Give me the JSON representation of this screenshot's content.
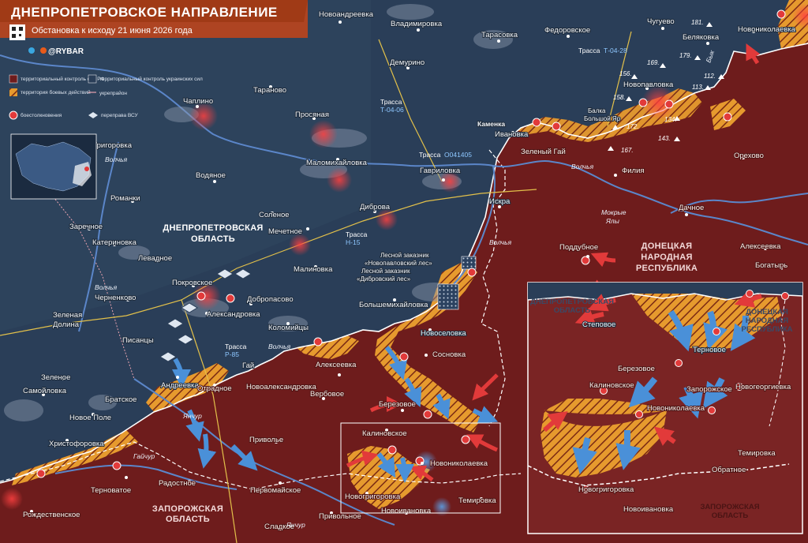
{
  "header": {
    "title": "ДНЕПРОПЕТРОВСКОЕ НАПРАВЛЕНИЕ",
    "subtitle": "Обстановка к исходу 21 июня 2026 года",
    "brand": "@RYBAR",
    "brand_color": "#e85a1a"
  },
  "legend": {
    "rf_control": "территориальный контроль сил РФ",
    "ua_control": "территориальный контроль украинских сил",
    "combat_zone": "территория боевых действий",
    "fortified": "укрепрайон",
    "clashes": "боестолкновения",
    "crossing": "переправа ВСУ"
  },
  "colors": {
    "rf_territory": "#6e1c1c",
    "ua_territory": "#2a3e58",
    "combat_hatch": "#e69a2e",
    "front_line": "#ffffff",
    "attack_arrow_rf": "#e23a3a",
    "attack_arrow_ua": "#4a90d8"
  },
  "regions": {
    "dnepro": [
      "ДНЕПРОПЕТРОВСКАЯ",
      "ОБЛАСТЬ"
    ],
    "donetsk": [
      "ДОНЕЦКАЯ",
      "НАРОДНАЯ",
      "РЕСПУБЛИКА"
    ],
    "zaporozhye": [
      "ЗАПОРОЖСКАЯ",
      "ОБЛАСТЬ"
    ]
  },
  "rivers": {
    "volchya_1": "Волчья",
    "volchya_2": "Волчья",
    "volchya_3": "Волчья",
    "volchya_4": "Волчья",
    "volchya_5": "Волчья",
    "yanchur_1": "Янчур",
    "yanchur_2": "Янчур",
    "gaichur": "Гайчур",
    "mokrye_yaly": [
      "Мокрые",
      "Ялы"
    ],
    "byk": "Бык"
  },
  "roads": {
    "t0406": [
      "Трасса",
      "Т-04-06"
    ],
    "t0428_label": "Трасса",
    "t0428_num": "Т-04-28",
    "o041405_label": "Трасса",
    "o041405_num": "О041405",
    "n15": [
      "Трасса",
      "Н-15"
    ],
    "r85": [
      "Трасса",
      "Р-85"
    ]
  },
  "reserves": {
    "novopavlovsky": [
      "Лесной заказник",
      "«Новопавловский лес»"
    ],
    "dibrovsky": [
      "Лесной заказник",
      "«Дибровский лес»"
    ],
    "balka": [
      "Балка",
      "Большой Яр"
    ]
  },
  "altitudes": [
    "181.",
    "179.",
    "169.",
    "156.",
    "112.",
    "113.",
    "158.",
    "134.",
    "172.",
    "143.",
    "167."
  ],
  "settlements": {
    "novoandreevka": "Новоандреевка",
    "vladimirovka": "Владимировка",
    "tarasovka": "Тарасовка",
    "fedorovskoe": "Федоровское",
    "chuguevo": "Чугуево",
    "belyakovka": "Беляковка",
    "novonikolaevka_ne": "Новониколаевка",
    "demurino": "Демурино",
    "chaplino": "Чаплино",
    "taranovo": "Тараново",
    "prosyanaya": "Просяная",
    "novopavlovka": "Новопавловка",
    "grigorovka": "Григоровка",
    "malomikhailovka": "Маломихайловка",
    "kamenka": "Каменка",
    "ivanovka": "Ивановка",
    "vodyanoe": "Водяное",
    "gavrilovka": "Гавриловка",
    "zeleny_gai": "Зеленый Гай",
    "filiya": "Филия",
    "orekhovo": "Орехово",
    "romanki": "Романки",
    "solenoe": "Соленое",
    "dibrova": "Диброва",
    "iskra": "Искра",
    "dachnoe": "Дачное",
    "zarechnoe": "Заречное",
    "mechetnoe": "Мечетное",
    "katerinovka": "Катериновка",
    "poddubnoe": "Поддубное",
    "alekseevka_e": "Алексеевка",
    "levadnoe": "Левадное",
    "bogatyr": "Богатырь",
    "malinovka": "Малиновка",
    "pokrovskoe": "Покровское",
    "chernenkovo": "Черненково",
    "dobropasovo": "Добропасово",
    "bolshemikhailovka": "Большемихайловка",
    "aleksandrovka": "Александровка",
    "zelenaya_dolina": [
      "Зеленая",
      "Долина"
    ],
    "kolomiytsy": "Коломийцы",
    "novoselovka": "Новоселовка",
    "pisantsy": "Писанцы",
    "sosnovka": "Сосновка",
    "gai": "Гай",
    "alekseevka": "Алексеевка",
    "zelenoe": "Зеленое",
    "andreevka": "Андреевка",
    "otradnoe": "Отрадное",
    "novoaleksandrovka": "Новоалександровка",
    "samoylovka": "Самойловка",
    "bratskoe": "Братское",
    "verbovoe": "Вербовое",
    "novoe_pole": "Новое Поле",
    "berezovoe": "Березовое",
    "kalinovskoe": "Калиновское",
    "khristoforovka": "Христофоровка",
    "privolye": "Приволье",
    "novonikolaevka": "Новониколаевка",
    "ternovatoe": "Терноватое",
    "radostnoe": "Радостное",
    "pervomayskoe": "Первомайское",
    "novogrigorovka": "Новогригоровка",
    "temirovka": "Темировка",
    "rozhdestvenskoe": "Рождественское",
    "privolnoe": "Привольное",
    "novoivanovka": "Новоивановка",
    "sladkoe": "Сладкое"
  },
  "inset": {
    "dnepro_region": [
      "ДНЕПРОПЕТРОВСКАЯ",
      "ОБЛАСТЬ"
    ],
    "donetsk_region": [
      "ДОНЕЦКАЯ",
      "НАРОДНАЯ",
      "РЕСПУБЛИКА"
    ],
    "zaporozhye_region": [
      "ЗАПОРОЖСКАЯ",
      "ОБЛАСТЬ"
    ],
    "stepovoe": "Степовое",
    "ternovoe": "Терновое",
    "berezovoe": "Березовое",
    "kalinovskoe": "Калиновское",
    "zaporozhskoe": "Запорожское",
    "novogeorgievka": "Новогеоргиевка",
    "novonikolaevka": "Новониколаевка",
    "temirovka": "Темировка",
    "obratnoe": "Обратное",
    "novogrigorovka": "Новогригоровка",
    "novoivanovka": "Новоивановка"
  }
}
